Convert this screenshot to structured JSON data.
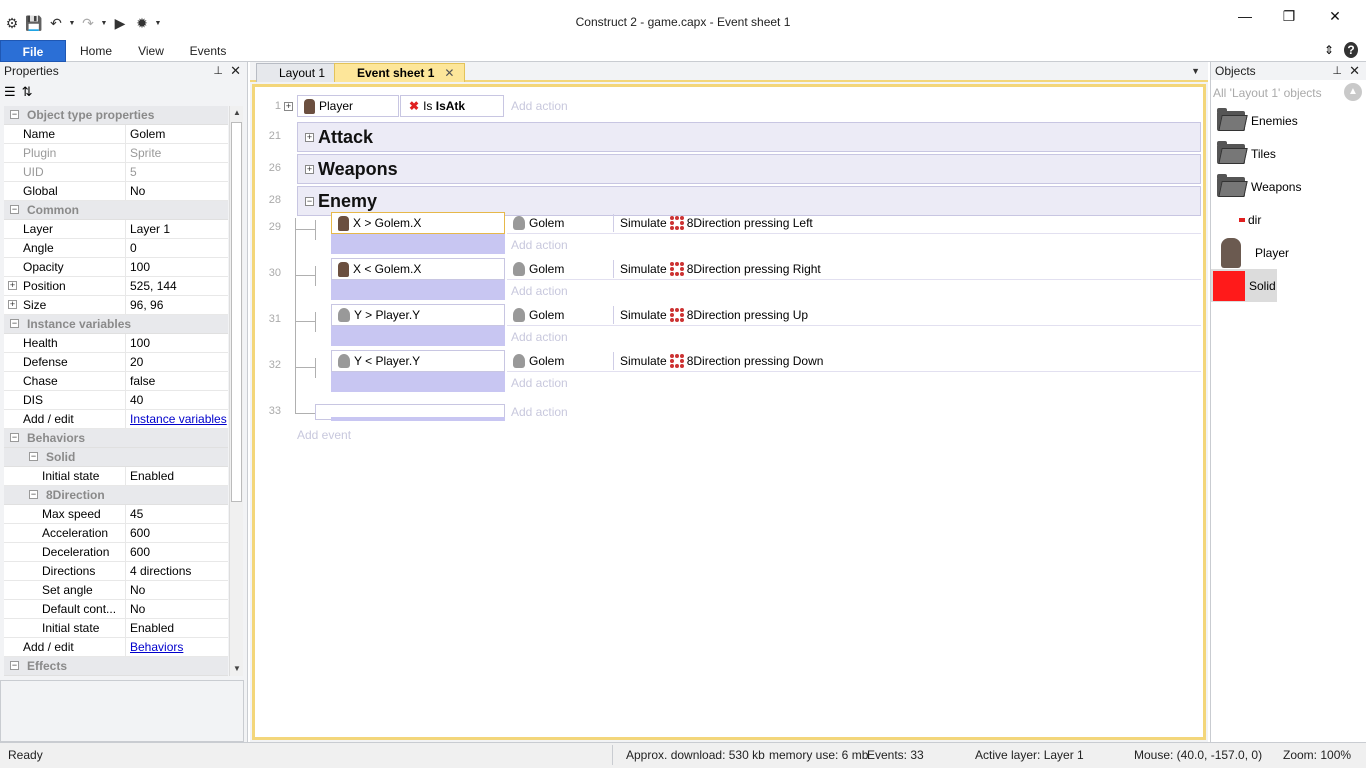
{
  "window": {
    "title": "Construct 2 - game.capx - Event sheet 1"
  },
  "ribbon": {
    "tabs": [
      "File",
      "Home",
      "View",
      "Events"
    ]
  },
  "properties": {
    "title": "Properties",
    "rows": [
      {
        "type": "head",
        "label": "Object type properties"
      },
      {
        "type": "row",
        "key": "Name",
        "value": "Golem"
      },
      {
        "type": "row",
        "key": "Plugin",
        "value": "Sprite",
        "disabled": true
      },
      {
        "type": "row",
        "key": "UID",
        "value": "5",
        "disabled": true
      },
      {
        "type": "row",
        "key": "Global",
        "value": "No"
      },
      {
        "type": "head",
        "label": "Common"
      },
      {
        "type": "row",
        "key": "Layer",
        "value": "Layer 1"
      },
      {
        "type": "row",
        "key": "Angle",
        "value": "0"
      },
      {
        "type": "row",
        "key": "Opacity",
        "value": "100"
      },
      {
        "type": "row",
        "key": "Position",
        "value": "525, 144",
        "expand": true
      },
      {
        "type": "row",
        "key": "Size",
        "value": "96, 96",
        "expand": true
      },
      {
        "type": "head",
        "label": "Instance variables"
      },
      {
        "type": "row",
        "key": "Health",
        "value": "100"
      },
      {
        "type": "row",
        "key": "Defense",
        "value": "20"
      },
      {
        "type": "row",
        "key": "Chase",
        "value": "false"
      },
      {
        "type": "row",
        "key": "DIS",
        "value": "40"
      },
      {
        "type": "row",
        "key": "Add / edit",
        "value": "Instance variables",
        "link": true
      },
      {
        "type": "head",
        "label": "Behaviors"
      },
      {
        "type": "subhead",
        "label": "Solid"
      },
      {
        "type": "row",
        "key": "Initial state",
        "value": "Enabled",
        "indent": true
      },
      {
        "type": "subhead",
        "label": "8Direction"
      },
      {
        "type": "row",
        "key": "Max speed",
        "value": "45",
        "indent": true
      },
      {
        "type": "row",
        "key": "Acceleration",
        "value": "600",
        "indent": true
      },
      {
        "type": "row",
        "key": "Deceleration",
        "value": "600",
        "indent": true
      },
      {
        "type": "row",
        "key": "Directions",
        "value": "4 directions",
        "indent": true
      },
      {
        "type": "row",
        "key": "Set angle",
        "value": "No",
        "indent": true
      },
      {
        "type": "row",
        "key": "Default cont...",
        "value": "No",
        "indent": true
      },
      {
        "type": "row",
        "key": "Initial state",
        "value": "Enabled",
        "indent": true
      },
      {
        "type": "row",
        "key": "Add / edit",
        "value": "Behaviors",
        "link": true
      },
      {
        "type": "head",
        "label": "Effects"
      }
    ]
  },
  "doc_tabs": [
    {
      "label": "Layout 1"
    },
    {
      "label": "Event sheet 1",
      "active": true
    }
  ],
  "events": {
    "add_action": "Add action",
    "add_event": "Add event",
    "top_event": {
      "num": "1",
      "object": "Player",
      "condition_prefix": "Is",
      "condition": "IsAtk"
    },
    "groups": [
      {
        "num": "21",
        "title": "Attack",
        "expanded": false
      },
      {
        "num": "26",
        "title": "Weapons",
        "expanded": false
      },
      {
        "num": "28",
        "title": "Enemy",
        "expanded": true
      }
    ],
    "sub_events": [
      {
        "num": "29",
        "condition": "X > Golem.X",
        "icon": "player",
        "object": "Golem",
        "action_prefix": "Simulate",
        "action": "8Direction pressing Left"
      },
      {
        "num": "30",
        "condition": "X < Golem.X",
        "icon": "player",
        "object": "Golem",
        "action_prefix": "Simulate",
        "action": "8Direction pressing Right"
      },
      {
        "num": "31",
        "condition": "Y > Player.Y",
        "icon": "golem",
        "object": "Golem",
        "action_prefix": "Simulate",
        "action": "8Direction pressing Up"
      },
      {
        "num": "32",
        "condition": "Y < Player.Y",
        "icon": "golem",
        "object": "Golem",
        "action_prefix": "Simulate",
        "action": "8Direction pressing Down"
      }
    ],
    "empty_event_num": "33"
  },
  "objects": {
    "title": "Objects",
    "filter_placeholder": "All 'Layout 1' objects",
    "items": [
      {
        "label": "Enemies",
        "kind": "folder"
      },
      {
        "label": "Tiles",
        "kind": "folder"
      },
      {
        "label": "Weapons",
        "kind": "folder"
      },
      {
        "label": "dir",
        "kind": "dot"
      },
      {
        "label": "Player",
        "kind": "sprite"
      },
      {
        "label": "Solid",
        "kind": "solid",
        "color": "#ff1a1a"
      }
    ]
  },
  "status": {
    "left": "Ready",
    "download": "Approx. download: 530 kb",
    "memory": "memory use: 6 mb",
    "events": "Events: 33",
    "layer": "Active layer: Layer 1",
    "mouse": "Mouse: (40.0, -157.0, 0)",
    "zoom": "Zoom: 100%"
  }
}
